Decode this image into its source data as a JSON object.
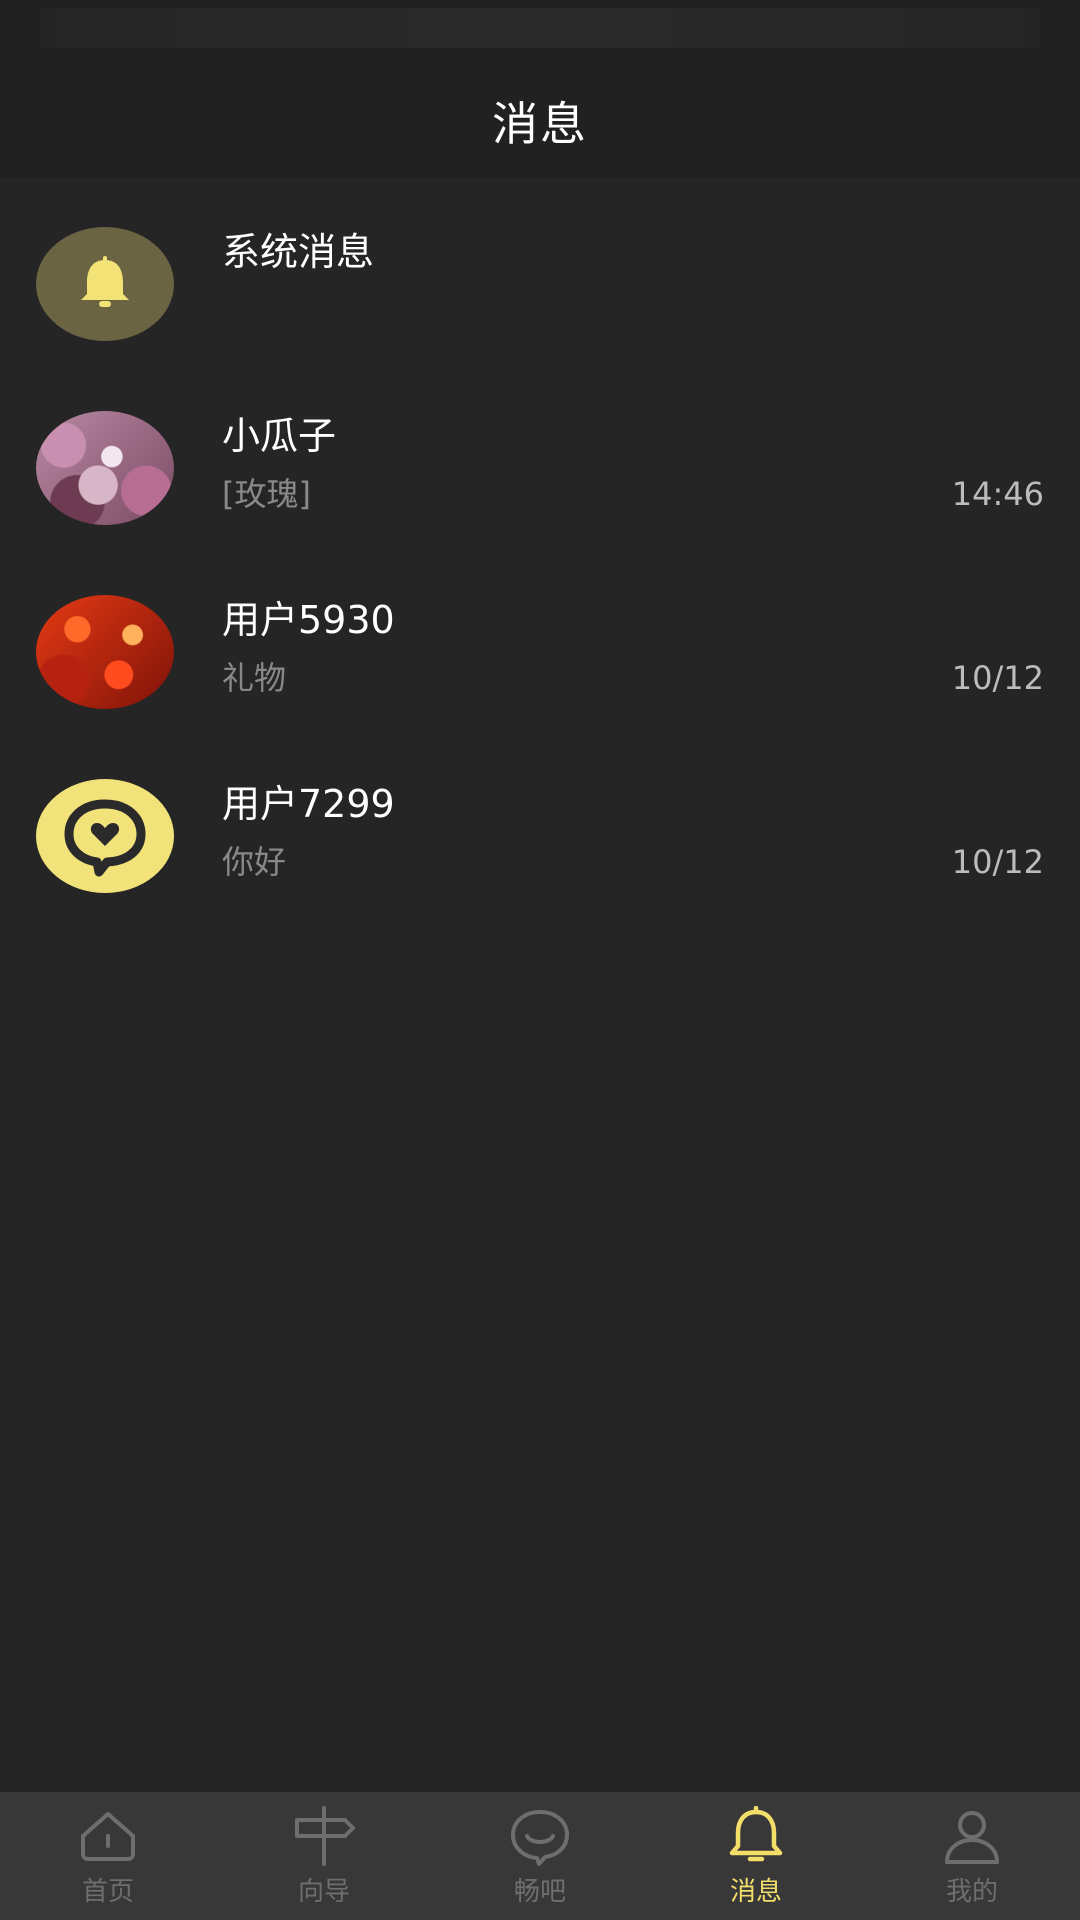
{
  "header": {
    "title": "消息"
  },
  "conversations": [
    {
      "name": "系统消息",
      "preview": "",
      "time": "",
      "avatar": "bell-avatar"
    },
    {
      "name": "小瓜子",
      "preview": "[玫瑰]",
      "time": "14:46",
      "avatar": "photo-avatar"
    },
    {
      "name": "用户5930",
      "preview": "礼物",
      "time": "10/12",
      "avatar": "photo-avatar"
    },
    {
      "name": "用户7299",
      "preview": "你好",
      "time": "10/12",
      "avatar": "chat-heart-avatar"
    }
  ],
  "tabbar": {
    "active": "消息",
    "items": [
      {
        "label": "首页",
        "icon": "home-icon"
      },
      {
        "label": "向导",
        "icon": "signpost-icon"
      },
      {
        "label": "畅吧",
        "icon": "chat-bubble-icon"
      },
      {
        "label": "消息",
        "icon": "bell-icon"
      },
      {
        "label": "我的",
        "icon": "user-icon"
      }
    ]
  },
  "colors": {
    "background": "#262526",
    "header": "#222122",
    "tabbar": "#393839",
    "accent": "#f3de6a",
    "inactive": "#6f6e6f"
  }
}
